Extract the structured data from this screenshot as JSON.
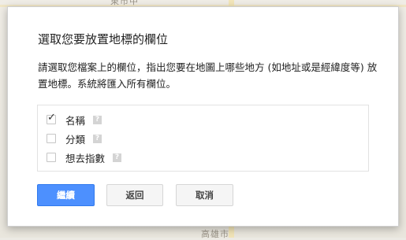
{
  "map": {
    "top_label": "東市中",
    "bottom_label": "高雄市"
  },
  "dialog": {
    "title": "選取您要放置地標的欄位",
    "description": "請選取您檔案上的欄位，指出您要在地圖上哪些地方 (如地址或是經緯度等) 放置地標。系統將匯入所有欄位。",
    "fields": [
      {
        "label": "名稱",
        "checked": true,
        "check_mark": "✓",
        "help_icon": "?"
      },
      {
        "label": "分類",
        "checked": false,
        "check_mark": "",
        "help_icon": "?"
      },
      {
        "label": "想去指數",
        "checked": false,
        "check_mark": "",
        "help_icon": "?"
      }
    ],
    "buttons": {
      "continue_label": "繼續",
      "back_label": "返回",
      "cancel_label": "取消"
    }
  },
  "colors": {
    "primary_button": "#4d90fe",
    "help_icon": "#d4d4d4"
  }
}
